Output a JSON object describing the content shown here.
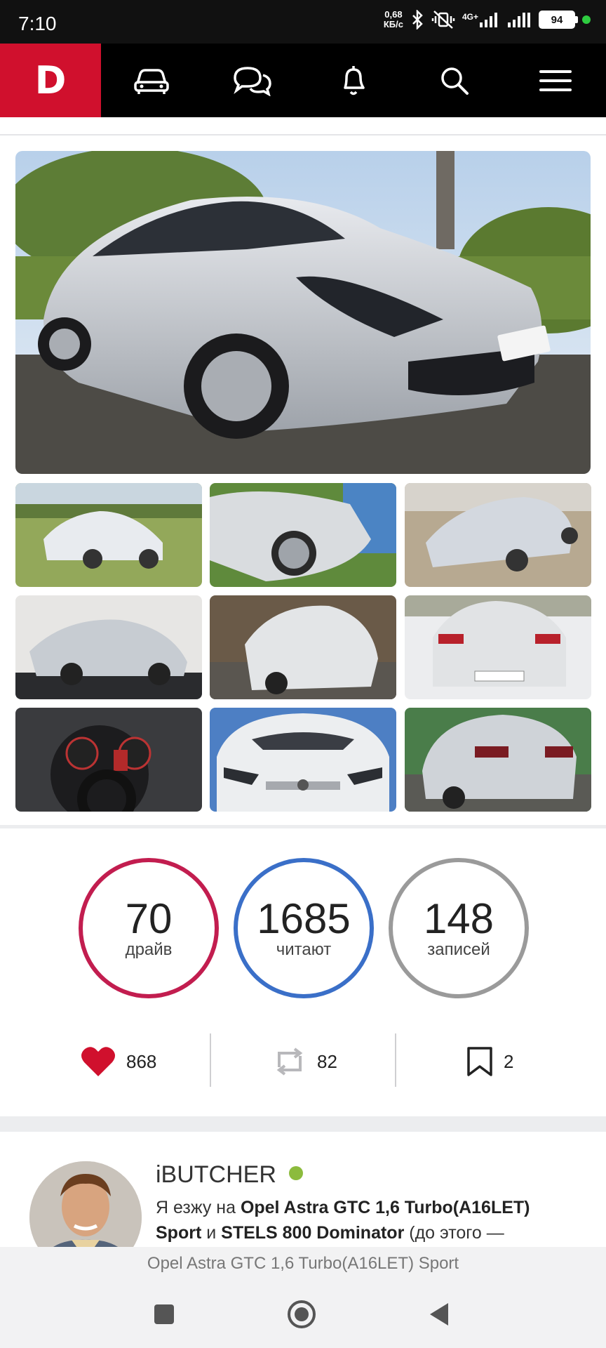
{
  "status_bar": {
    "time": "7:10",
    "net_speed_value": "0,68",
    "net_speed_unit": "КБ/с",
    "network": "4G+",
    "battery": "94"
  },
  "navbar": {
    "logo": "D",
    "items": [
      "car-icon",
      "chat-icon",
      "bell-icon",
      "search-icon",
      "menu-icon"
    ]
  },
  "stats": [
    {
      "value": "70",
      "label": "драйв",
      "color": "#c21d4f"
    },
    {
      "value": "1685",
      "label": "читают",
      "color": "#3a6fc8"
    },
    {
      "value": "148",
      "label": "записей",
      "color": "#9a9a9a"
    }
  ],
  "actions": {
    "likes": "868",
    "reposts": "82",
    "bookmarks": "2"
  },
  "user": {
    "name": "iBUTCHER",
    "bio_prefix": "Я езжу на ",
    "bio_car1": "Opel Astra GTC 1,6 Turbo(A16LET) Sport",
    "bio_and": " и ",
    "bio_car2": "STELS 800 Dominator",
    "bio_suffix": " (до этого —"
  },
  "bottom_caption": "Opel Astra GTC 1,6 Turbo(A16LET) Sport"
}
